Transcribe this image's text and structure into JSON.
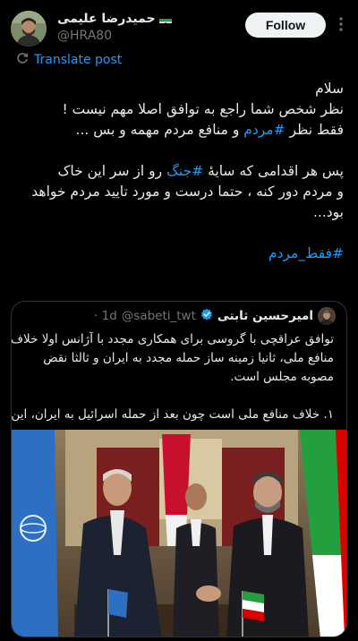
{
  "author": {
    "name": "حمیدرضا علیمی",
    "handle": "@HRA80",
    "flag_icon": "iran-flag-icon"
  },
  "follow_label": "Follow",
  "translate_label": "Translate post",
  "post": {
    "l1": "سلام",
    "l2": "نظر شخص شما راجع به توافق اصلا مهم نیست !",
    "l3_pre": "فقط نظر ",
    "l3_tag": "#مردم",
    "l3_post": " و منافع مردم مهمه و بس ...",
    "l4_pre": "پس هر اقدامی که سایهٔ ",
    "l4_tag": "#جنگ",
    "l4_post": " رو از سر این خاک",
    "l5": "و مردم دور کنه ، حتما درست و مورد تایید مردم خواهد",
    "l6": "بود...",
    "l7_tag": "#فقط_مردم"
  },
  "quote": {
    "name": "امیرحسین ثابتی",
    "handle": "@sabeti_twt",
    "time": "· 1d",
    "verified_icon": "verified-badge-icon",
    "t1": "توافق عراقچی با گروسی برای همکاری مجدد با آژانس اولا خلاف",
    "t2": "منافع ملی، ثانیا زمینه ساز حمله مجدد به ایران و ثالثا نقض",
    "t3": "مصوبه مجلس است.",
    "t4": "۱. خلاف منافع ملی است چون بعد از حمله اسرائیل به ایران، این..."
  },
  "colors": {
    "background": "#000000",
    "link": "#1d9bf0",
    "text": "#e7e9ea",
    "muted": "#71767b",
    "border": "#2f3336"
  }
}
